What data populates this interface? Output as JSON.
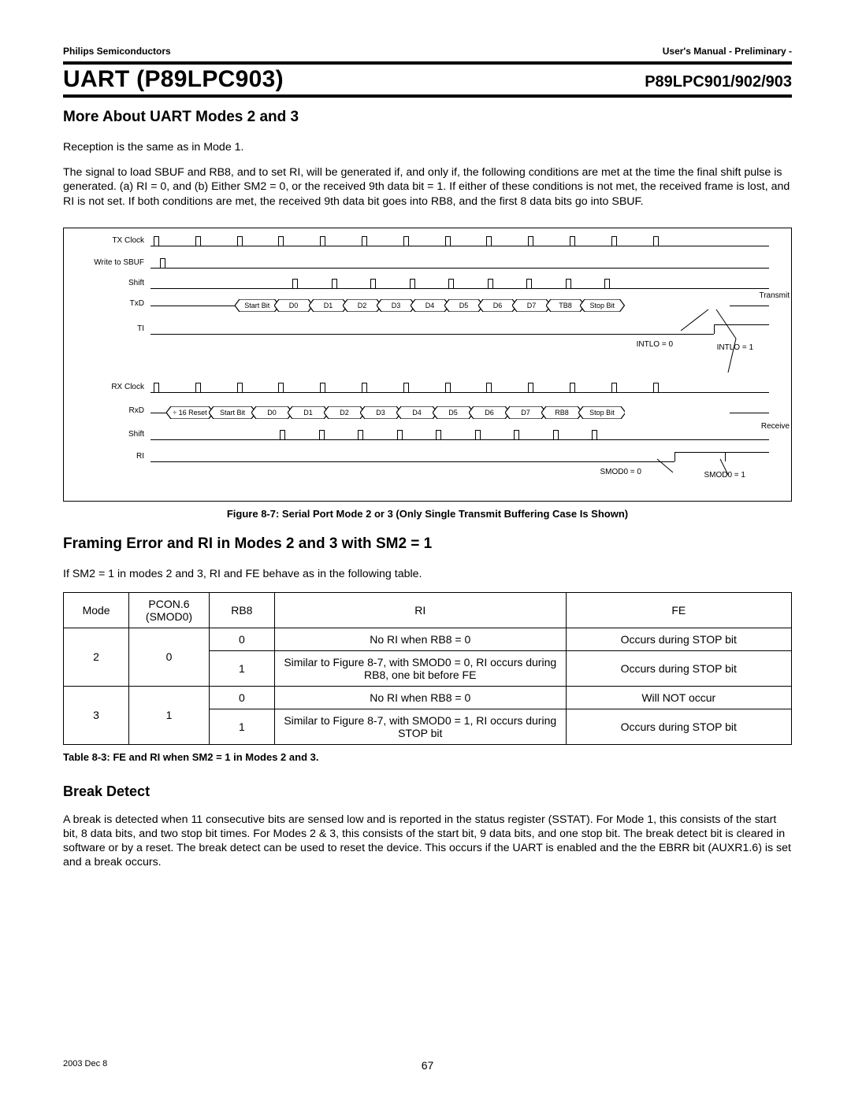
{
  "header": {
    "left": "Philips Semiconductors",
    "right": "User's Manual - Preliminary -"
  },
  "titleband": {
    "main": "UART (P89LPC903)",
    "sub": "P89LPC901/902/903"
  },
  "sections": {
    "s1_title": "More About UART Modes 2 and 3",
    "s1_p1": "Reception is the same as in Mode 1.",
    "s1_p2": "The signal to load SBUF and RB8, and to set RI, will be generated if, and only if, the following conditions are met at the time the final shift pulse is generated. (a) RI = 0, and (b) Either SM2 = 0, or the received 9th data bit = 1. If either of these conditions is not met, the received frame is lost, and RI is not set. If both conditions are met, the received 9th data bit goes into RB8, and the first 8 data bits go into SBUF.",
    "s2_title": "Framing Error and RI in Modes 2 and 3 with SM2 = 1",
    "s2_p1": "If SM2 = 1 in modes 2 and 3, RI and FE behave as in the following table.",
    "s3_title": "Break Detect",
    "s3_p1": "A break is detected  when 11 consecutive bits are sensed low and is reported in the status register (SSTAT). For Mode 1, this consists of the start bit, 8 data bits, and two stop bit times. For Modes 2 & 3, this consists of the start bit, 9 data bits, and one stop bit. The break detect bit is cleared in software or by a reset. The break detect can be used to reset the device. This occurs if the UART is enabled and the the EBRR bit (AUXR1.6) is set and a break occurs."
  },
  "figure": {
    "caption": "Figure 8-7: Serial Port Mode 2 or 3 (Only Single Transmit Buffering Case Is Shown)",
    "signals_tx": [
      "TX Clock",
      "Write to SBUF",
      "Shift",
      "TxD",
      "TI"
    ],
    "signals_rx": [
      "RX Clock",
      "RxD",
      "Shift",
      "RI"
    ],
    "bus_labels": [
      "Start Bit",
      "D0",
      "D1",
      "D2",
      "D3",
      "D4",
      "D5",
      "D6",
      "D7",
      "TB8",
      "Stop Bit"
    ],
    "rx_bus_labels": [
      "÷ 16 Reset",
      "Start Bit",
      "D0",
      "D1",
      "D2",
      "D3",
      "D4",
      "D5",
      "D6",
      "D7",
      "RB8",
      "Stop Bit"
    ],
    "side_tx": "Transmit",
    "side_rx": "Receive",
    "ann_intlo0": "INTLO = 0",
    "ann_intlo1": "INTLO = 1",
    "ann_smod0_0": "SMOD0 = 0",
    "ann_smod0_1": "SMOD0 = 1"
  },
  "table": {
    "headers": [
      "Mode",
      "PCON.6 (SMOD0)",
      "RB8",
      "RI",
      "FE"
    ],
    "rows": [
      {
        "mode": "2",
        "smod0": "0",
        "rb8": "0",
        "ri": "No RI when RB8 = 0",
        "fe": "Occurs during STOP bit"
      },
      {
        "mode": "",
        "smod0": "",
        "rb8": "1",
        "ri": "Similar to Figure 8-7, with SMOD0 = 0, RI occurs during RB8, one bit before FE",
        "fe": "Occurs during STOP bit"
      },
      {
        "mode": "3",
        "smod0": "1",
        "rb8": "0",
        "ri": "No RI when RB8 = 0",
        "fe": "Will NOT occur"
      },
      {
        "mode": "",
        "smod0": "",
        "rb8": "1",
        "ri": "Similar to Figure 8-7, with SMOD0 = 1, RI occurs during STOP bit",
        "fe": "Occurs during STOP bit"
      }
    ],
    "caption": "Table 8-3: FE and RI when SM2 = 1 in Modes 2 and 3."
  },
  "footer": {
    "date": "2003 Dec 8",
    "page": "67"
  },
  "chart_data": {
    "type": "timing-diagram",
    "title": "Serial Port Mode 2 or 3 (Only Single Transmit Buffering Case Is Shown)",
    "clock_pulses": 13,
    "tx": {
      "signals": [
        "TX Clock",
        "Write to SBUF",
        "Shift",
        "TxD",
        "TI"
      ],
      "txd_sequence": [
        "Start Bit",
        "D0",
        "D1",
        "D2",
        "D3",
        "D4",
        "D5",
        "D6",
        "D7",
        "TB8",
        "Stop Bit"
      ],
      "ti_annotations": [
        "INTLO = 0",
        "INTLO = 1"
      ]
    },
    "rx": {
      "signals": [
        "RX Clock",
        "RxD",
        "Shift",
        "RI"
      ],
      "rxd_sequence": [
        "÷ 16 Reset",
        "Start Bit",
        "D0",
        "D1",
        "D2",
        "D3",
        "D4",
        "D5",
        "D6",
        "D7",
        "RB8",
        "Stop Bit"
      ],
      "ri_annotations": [
        "SMOD0 = 0",
        "SMOD0 = 1"
      ]
    }
  }
}
